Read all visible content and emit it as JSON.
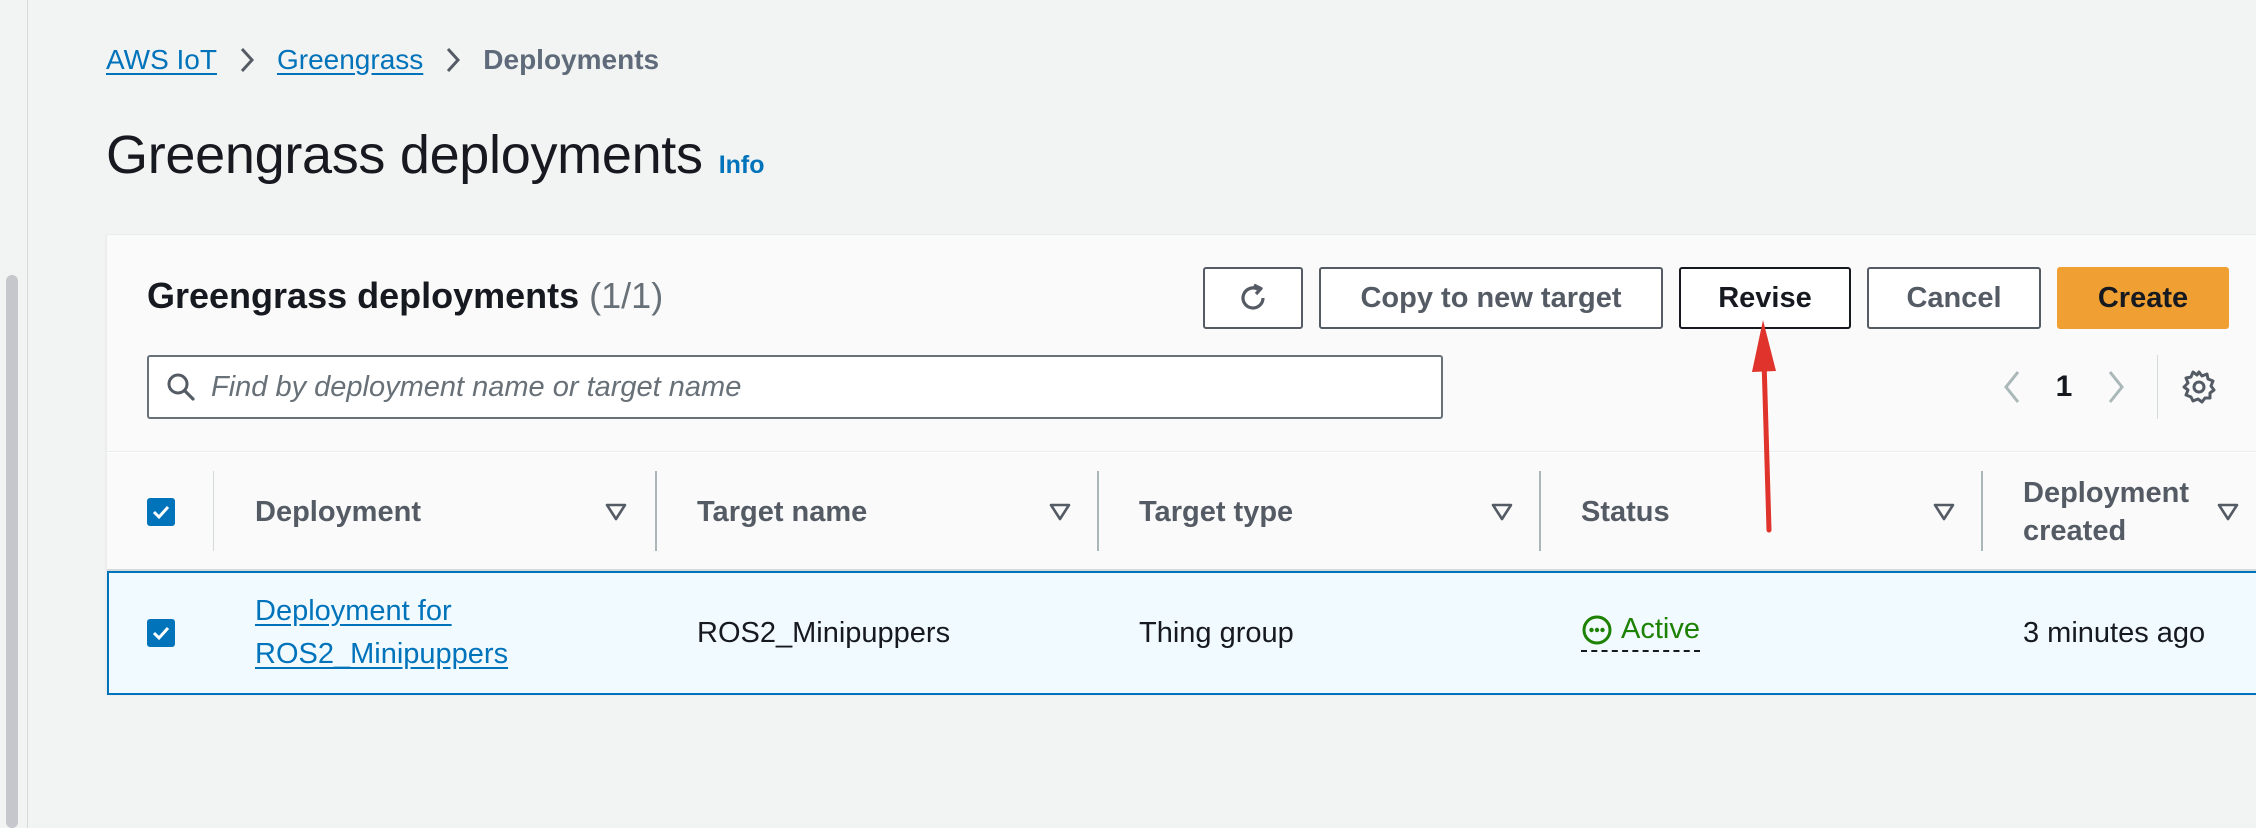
{
  "breadcrumb": {
    "items": [
      {
        "label": "AWS IoT"
      },
      {
        "label": "Greengrass"
      },
      {
        "label": "Deployments"
      }
    ]
  },
  "page": {
    "title": "Greengrass deployments",
    "info_label": "Info"
  },
  "section": {
    "title": "Greengrass deployments",
    "count": "(1/1)"
  },
  "toolbar": {
    "copy_label": "Copy to new target",
    "revise_label": "Revise",
    "cancel_label": "Cancel",
    "create_label": "Create"
  },
  "search": {
    "placeholder": "Find by deployment name or target name",
    "value": ""
  },
  "pagination": {
    "current_page": "1"
  },
  "table": {
    "columns": [
      {
        "label": "Deployment"
      },
      {
        "label": "Target name"
      },
      {
        "label": "Target type"
      },
      {
        "label": "Status"
      },
      {
        "label_line1": "Deployment",
        "label_line2": "created"
      }
    ],
    "rows": [
      {
        "deployment_line1": "Deployment for",
        "deployment_line2": "ROS2_Minipuppers",
        "target_name": "ROS2_Minipuppers",
        "target_type": "Thing group",
        "status": "Active",
        "created": "3 minutes ago",
        "selected": true
      }
    ]
  },
  "colors": {
    "link": "#0073bb",
    "primary_button": "#f0a032",
    "status_active": "#1d8102",
    "annotation_arrow": "#e0332b"
  },
  "icons": [
    "chevron-right-icon",
    "refresh-icon",
    "search-icon",
    "chevron-left-icon",
    "gear-icon",
    "sort-caret-icon",
    "checkmark-icon",
    "status-in-progress-icon"
  ]
}
